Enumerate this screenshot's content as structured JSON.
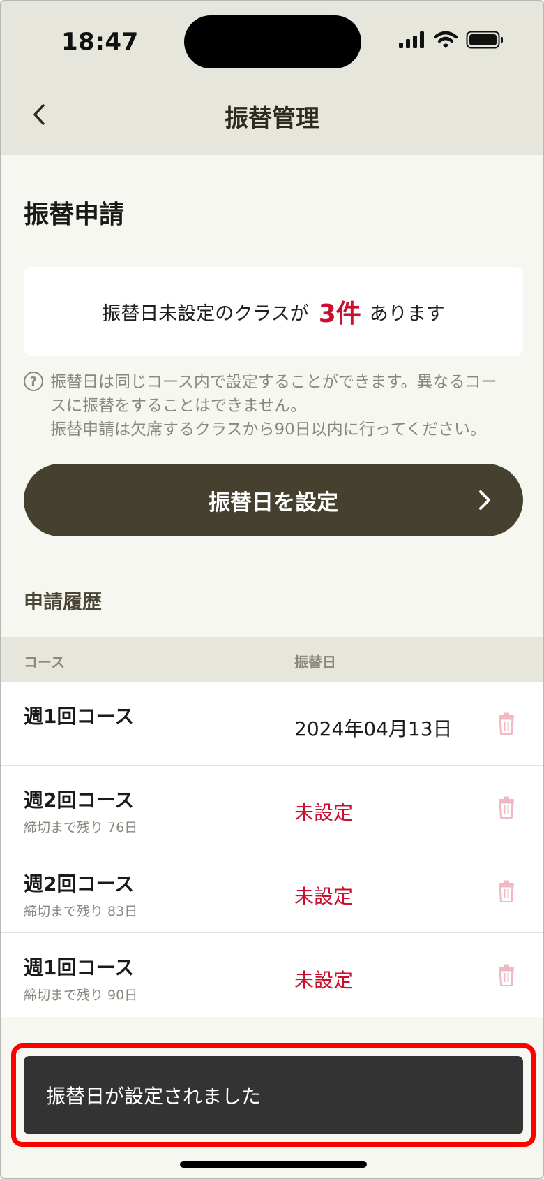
{
  "status_bar": {
    "time": "18:47",
    "icons": [
      "signal-icon",
      "wifi-icon",
      "battery-icon"
    ]
  },
  "header": {
    "title": "振替管理",
    "back_icon": "chevron-left-icon"
  },
  "section_title": "振替申請",
  "notice": {
    "prefix": "振替日未設定のクラスが",
    "count": "3件",
    "suffix": "あります"
  },
  "help": {
    "icon": "question-circle-icon",
    "line1": "振替日は同じコース内で設定することができます。異なるコー",
    "line2": "スに振替をすることはできません。",
    "line3": "振替申請は欠席するクラスから90日以内に行ってください。"
  },
  "primary_button": {
    "label": "振替日を設定",
    "icon": "chevron-right-icon"
  },
  "history": {
    "title": "申請履歴",
    "columns": [
      "コース",
      "振替日"
    ],
    "rows": [
      {
        "course": "週1回コース",
        "deadline": "",
        "date": "2024年04月13日",
        "unset": false
      },
      {
        "course": "週2回コース",
        "deadline": "締切まで残り 76日",
        "date": "未設定",
        "unset": true
      },
      {
        "course": "週2回コース",
        "deadline": "締切まで残り 83日",
        "date": "未設定",
        "unset": true
      },
      {
        "course": "週1回コース",
        "deadline": "締切まで残り 90日",
        "date": "未設定",
        "unset": true
      }
    ]
  },
  "toast": {
    "message": "振替日が設定されました"
  },
  "colors": {
    "accent_red": "#c8102e",
    "button_dark": "#46402e",
    "header_bg": "#e7e6dd",
    "toast_bg": "#333333",
    "highlight_border": "#ff0000"
  }
}
